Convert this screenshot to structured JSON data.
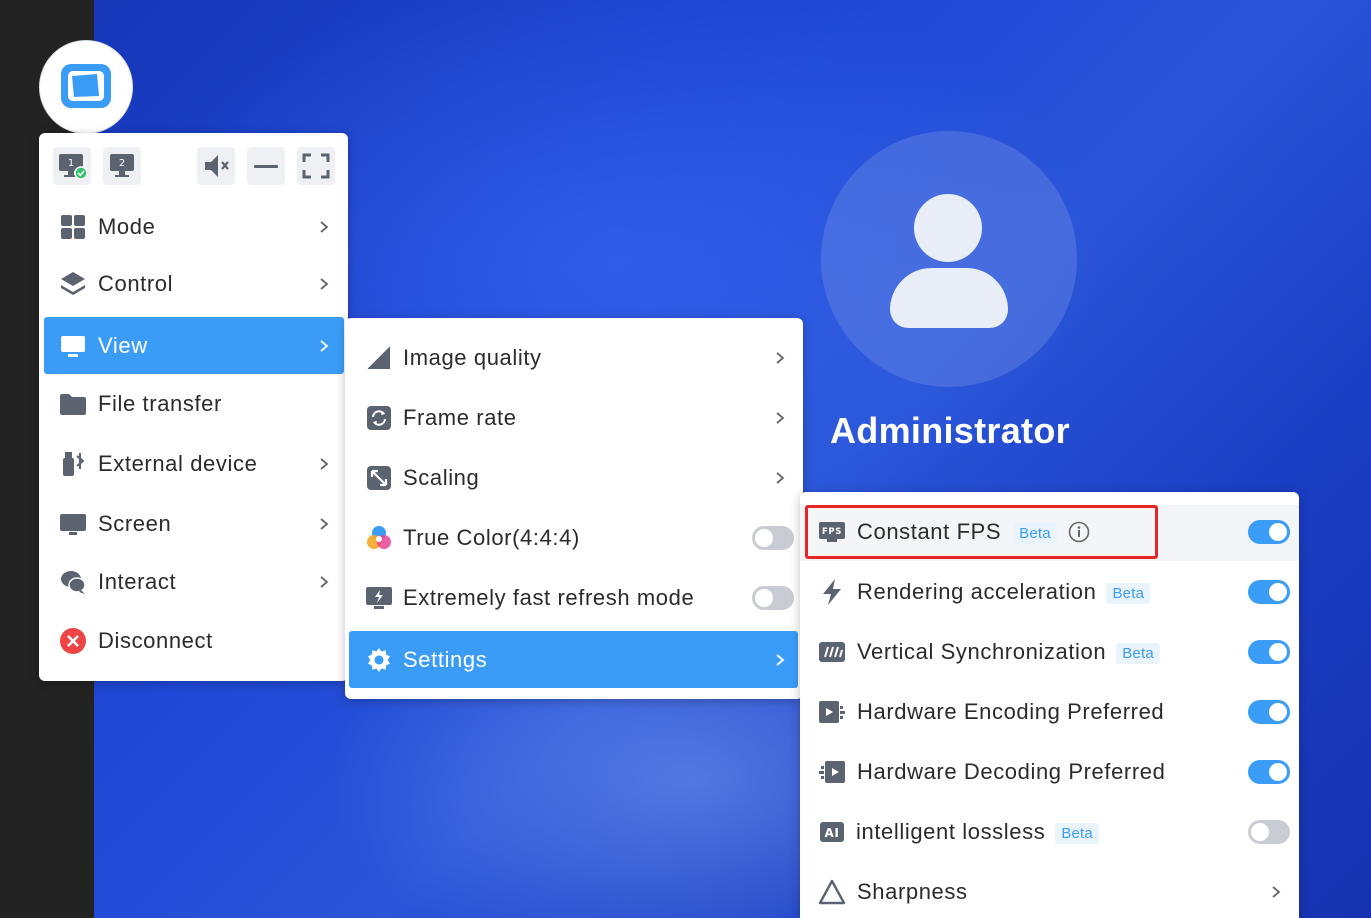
{
  "desktop": {
    "user_name": "Administrator"
  },
  "app": {
    "logo_icon": "remote-desktop-logo-icon",
    "accent_color": "#3b9cf8"
  },
  "toolbar": {
    "monitor_1_label": "1",
    "monitor_2_label": "2",
    "mute_icon": "speaker-muted-icon",
    "minimize_icon": "minimize-icon",
    "fullscreen_icon": "fullscreen-icon"
  },
  "main_menu": {
    "items": [
      {
        "label": "Mode",
        "icon": "grid-icon",
        "has_submenu": true
      },
      {
        "label": "Control",
        "icon": "layers-icon",
        "has_submenu": true
      },
      {
        "label": "View",
        "icon": "monitor-icon",
        "has_submenu": true,
        "active": true
      },
      {
        "label": "File transfer",
        "icon": "folder-icon",
        "has_submenu": false
      },
      {
        "label": "External device",
        "icon": "usb-bluetooth-icon",
        "has_submenu": true
      },
      {
        "label": "Screen",
        "icon": "screen-icon",
        "has_submenu": true
      },
      {
        "label": "Interact",
        "icon": "chat-icon",
        "has_submenu": true
      },
      {
        "label": "Disconnect",
        "icon": "disconnect-icon",
        "has_submenu": false
      }
    ]
  },
  "view_menu": {
    "items": [
      {
        "label": "Image quality",
        "icon": "image-quality-icon",
        "type": "submenu"
      },
      {
        "label": "Frame rate",
        "icon": "frame-rate-icon",
        "type": "submenu"
      },
      {
        "label": "Scaling",
        "icon": "scaling-icon",
        "type": "submenu"
      },
      {
        "label": "True Color(4:4:4)",
        "icon": "true-color-icon",
        "type": "toggle",
        "on": false
      },
      {
        "label": "Extremely fast refresh mode",
        "icon": "fast-refresh-icon",
        "type": "toggle",
        "on": false
      },
      {
        "label": "Settings",
        "icon": "gear-icon",
        "type": "submenu",
        "active": true
      }
    ]
  },
  "settings_menu": {
    "beta_label": "Beta",
    "items": [
      {
        "label": "Constant FPS",
        "icon": "fps-icon",
        "beta": true,
        "info": true,
        "type": "toggle",
        "on": true
      },
      {
        "label": "Rendering acceleration",
        "icon": "lightning-icon",
        "beta": true,
        "type": "toggle",
        "on": true
      },
      {
        "label": "Vertical Synchronization",
        "icon": "vsync-icon",
        "beta": true,
        "type": "toggle",
        "on": true
      },
      {
        "label": "Hardware Encoding Preferred",
        "icon": "hw-encoding-icon",
        "beta": false,
        "type": "toggle",
        "on": true
      },
      {
        "label": "Hardware Decoding Preferred",
        "icon": "hw-decoding-icon",
        "beta": false,
        "type": "toggle",
        "on": true
      },
      {
        "label": "intelligent lossless",
        "icon": "ai-icon",
        "beta": true,
        "type": "toggle",
        "on": false
      },
      {
        "label": "Sharpness",
        "icon": "triangle-icon",
        "beta": false,
        "type": "submenu"
      }
    ]
  }
}
